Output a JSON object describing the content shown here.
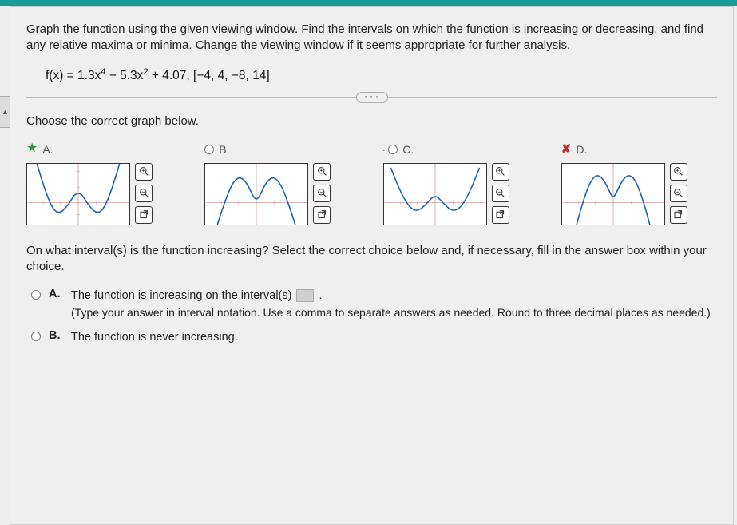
{
  "question_text": "Graph the function using the given viewing window. Find the intervals on which the function is increasing or decreasing, and find any relative maxima or minima. Change the viewing window if it seems appropriate for further analysis.",
  "formula_html": "f(x) = 1.3x<sup>4</sup> − 5.3x<sup>2</sup> + 4.07, [−4, 4, −8, 14]",
  "choose_text": "Choose the correct graph below.",
  "dots": "• • •",
  "side_tab": "▲",
  "options": [
    {
      "letter": "A.",
      "state": "correct"
    },
    {
      "letter": "B.",
      "state": "unselected"
    },
    {
      "letter": "C.",
      "state": "unselected"
    },
    {
      "letter": "D.",
      "state": "wrong"
    }
  ],
  "tools": {
    "zoom_in": "zoom-in-icon",
    "zoom_out": "zoom-out-icon",
    "popout": "popout-icon"
  },
  "interval_q": "On what interval(s) is the function increasing? Select the correct choice below and, if necessary, fill in the answer box within your choice.",
  "sub_options": {
    "a": {
      "letter": "A.",
      "text": "The function is increasing on the interval(s)",
      "hint": "(Type your answer in interval notation. Use a comma to separate answers as needed. Round to three decimal places as needed.)"
    },
    "b": {
      "letter": "B.",
      "text": "The function is never increasing."
    }
  },
  "chart_data": [
    {
      "type": "line",
      "option": "A",
      "xlim": [
        -4,
        4
      ],
      "ylim": [
        -8,
        14
      ],
      "description": "Quartic W-shape, two local minima dipping below x-axis, local max near y=4 at x=0, rises steeply at both ends above frame"
    },
    {
      "type": "line",
      "option": "B",
      "xlim": [
        -4,
        4
      ],
      "ylim": [
        -8,
        14
      ],
      "description": "Inverted quartic M-shape, two local maxima above x-axis, local min at center, falls steeply at both ends"
    },
    {
      "type": "line",
      "option": "C",
      "xlim": [
        -4,
        4
      ],
      "ylim": [
        -8,
        14
      ],
      "description": "Quartic W-shape similar to A but shallower / different vertical scaling"
    },
    {
      "type": "line",
      "option": "D",
      "xlim": [
        -4,
        4
      ],
      "ylim": [
        -8,
        14
      ],
      "description": "Inverted quartic M-shape with taller peaks, falls at both ends"
    }
  ]
}
